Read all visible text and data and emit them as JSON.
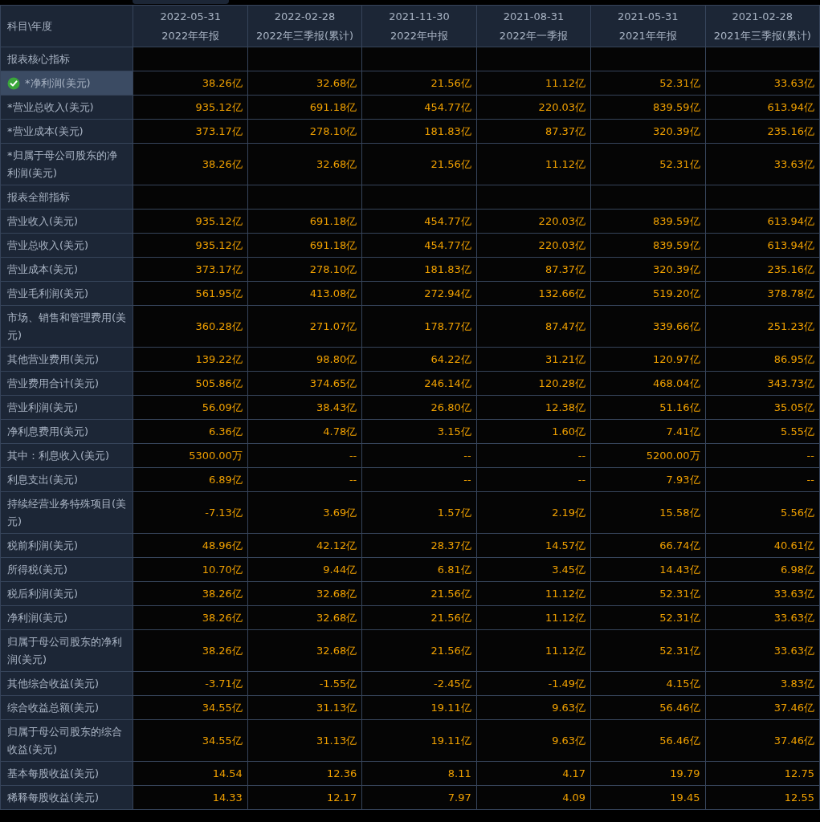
{
  "corner_header": "科目\\年度",
  "columns": [
    {
      "date": "2022-05-31",
      "period": "2022年年报"
    },
    {
      "date": "2022-02-28",
      "period": "2022年三季报(累计)"
    },
    {
      "date": "2021-11-30",
      "period": "2022年中报"
    },
    {
      "date": "2021-08-31",
      "period": "2022年一季报"
    },
    {
      "date": "2021-05-31",
      "period": "2021年年报"
    },
    {
      "date": "2021-02-28",
      "period": "2021年三季报(累计)"
    }
  ],
  "rows": [
    {
      "kind": "section",
      "label": "报表核心指标"
    },
    {
      "kind": "data",
      "selected": true,
      "label": "*净利润(美元)",
      "values": [
        "38.26亿",
        "32.68亿",
        "21.56亿",
        "11.12亿",
        "52.31亿",
        "33.63亿"
      ]
    },
    {
      "kind": "data",
      "selected": false,
      "label": "*营业总收入(美元)",
      "values": [
        "935.12亿",
        "691.18亿",
        "454.77亿",
        "220.03亿",
        "839.59亿",
        "613.94亿"
      ]
    },
    {
      "kind": "data",
      "selected": false,
      "label": "*营业成本(美元)",
      "values": [
        "373.17亿",
        "278.10亿",
        "181.83亿",
        "87.37亿",
        "320.39亿",
        "235.16亿"
      ]
    },
    {
      "kind": "data",
      "selected": false,
      "label": "*归属于母公司股东的净利润(美元)",
      "values": [
        "38.26亿",
        "32.68亿",
        "21.56亿",
        "11.12亿",
        "52.31亿",
        "33.63亿"
      ]
    },
    {
      "kind": "section",
      "label": "报表全部指标"
    },
    {
      "kind": "data",
      "selected": false,
      "label": "营业收入(美元)",
      "values": [
        "935.12亿",
        "691.18亿",
        "454.77亿",
        "220.03亿",
        "839.59亿",
        "613.94亿"
      ]
    },
    {
      "kind": "data",
      "selected": false,
      "label": "营业总收入(美元)",
      "values": [
        "935.12亿",
        "691.18亿",
        "454.77亿",
        "220.03亿",
        "839.59亿",
        "613.94亿"
      ]
    },
    {
      "kind": "data",
      "selected": false,
      "label": "营业成本(美元)",
      "values": [
        "373.17亿",
        "278.10亿",
        "181.83亿",
        "87.37亿",
        "320.39亿",
        "235.16亿"
      ]
    },
    {
      "kind": "data",
      "selected": false,
      "label": "营业毛利润(美元)",
      "values": [
        "561.95亿",
        "413.08亿",
        "272.94亿",
        "132.66亿",
        "519.20亿",
        "378.78亿"
      ]
    },
    {
      "kind": "data",
      "selected": false,
      "label": "市场、销售和管理费用(美元)",
      "values": [
        "360.28亿",
        "271.07亿",
        "178.77亿",
        "87.47亿",
        "339.66亿",
        "251.23亿"
      ]
    },
    {
      "kind": "data",
      "selected": false,
      "label": "其他营业费用(美元)",
      "values": [
        "139.22亿",
        "98.80亿",
        "64.22亿",
        "31.21亿",
        "120.97亿",
        "86.95亿"
      ]
    },
    {
      "kind": "data",
      "selected": false,
      "label": "营业费用合计(美元)",
      "values": [
        "505.86亿",
        "374.65亿",
        "246.14亿",
        "120.28亿",
        "468.04亿",
        "343.73亿"
      ]
    },
    {
      "kind": "data",
      "selected": false,
      "label": "营业利润(美元)",
      "values": [
        "56.09亿",
        "38.43亿",
        "26.80亿",
        "12.38亿",
        "51.16亿",
        "35.05亿"
      ]
    },
    {
      "kind": "data",
      "selected": false,
      "label": "净利息费用(美元)",
      "values": [
        "6.36亿",
        "4.78亿",
        "3.15亿",
        "1.60亿",
        "7.41亿",
        "5.55亿"
      ]
    },
    {
      "kind": "data",
      "selected": false,
      "label": "其中：利息收入(美元)",
      "values": [
        "5300.00万",
        "--",
        "--",
        "--",
        "5200.00万",
        "--"
      ]
    },
    {
      "kind": "data",
      "selected": false,
      "label": "利息支出(美元)",
      "values": [
        "6.89亿",
        "--",
        "--",
        "--",
        "7.93亿",
        "--"
      ]
    },
    {
      "kind": "data",
      "selected": false,
      "label": "持续经营业务特殊项目(美元)",
      "values": [
        "-7.13亿",
        "3.69亿",
        "1.57亿",
        "2.19亿",
        "15.58亿",
        "5.56亿"
      ]
    },
    {
      "kind": "data",
      "selected": false,
      "label": "税前利润(美元)",
      "values": [
        "48.96亿",
        "42.12亿",
        "28.37亿",
        "14.57亿",
        "66.74亿",
        "40.61亿"
      ]
    },
    {
      "kind": "data",
      "selected": false,
      "label": "所得税(美元)",
      "values": [
        "10.70亿",
        "9.44亿",
        "6.81亿",
        "3.45亿",
        "14.43亿",
        "6.98亿"
      ]
    },
    {
      "kind": "data",
      "selected": false,
      "label": "税后利润(美元)",
      "values": [
        "38.26亿",
        "32.68亿",
        "21.56亿",
        "11.12亿",
        "52.31亿",
        "33.63亿"
      ]
    },
    {
      "kind": "data",
      "selected": false,
      "label": "净利润(美元)",
      "values": [
        "38.26亿",
        "32.68亿",
        "21.56亿",
        "11.12亿",
        "52.31亿",
        "33.63亿"
      ]
    },
    {
      "kind": "data",
      "selected": false,
      "label": "归属于母公司股东的净利润(美元)",
      "values": [
        "38.26亿",
        "32.68亿",
        "21.56亿",
        "11.12亿",
        "52.31亿",
        "33.63亿"
      ]
    },
    {
      "kind": "data",
      "selected": false,
      "label": "其他综合收益(美元)",
      "values": [
        "-3.71亿",
        "-1.55亿",
        "-2.45亿",
        "-1.49亿",
        "4.15亿",
        "3.83亿"
      ]
    },
    {
      "kind": "data",
      "selected": false,
      "label": "综合收益总额(美元)",
      "values": [
        "34.55亿",
        "31.13亿",
        "19.11亿",
        "9.63亿",
        "56.46亿",
        "37.46亿"
      ]
    },
    {
      "kind": "data",
      "selected": false,
      "label": "归属于母公司股东的综合收益(美元)",
      "values": [
        "34.55亿",
        "31.13亿",
        "19.11亿",
        "9.63亿",
        "56.46亿",
        "37.46亿"
      ]
    },
    {
      "kind": "data",
      "selected": false,
      "label": "基本每股收益(美元)",
      "values": [
        "14.54",
        "12.36",
        "8.11",
        "4.17",
        "19.79",
        "12.75"
      ]
    },
    {
      "kind": "data",
      "selected": false,
      "label": "稀释每股收益(美元)",
      "values": [
        "14.33",
        "12.17",
        "7.97",
        "4.09",
        "19.45",
        "12.55"
      ]
    }
  ]
}
